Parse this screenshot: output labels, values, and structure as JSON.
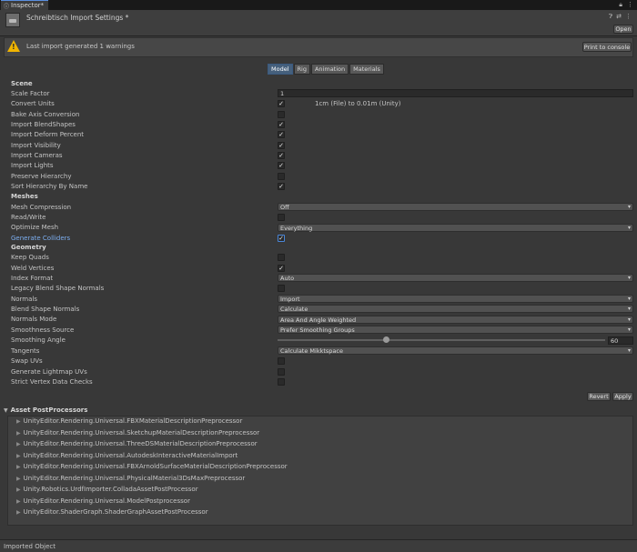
{
  "tab": {
    "title": "Inspector*",
    "menu_icon": "kebab-icon"
  },
  "header": {
    "title": "Schreibtisch Import Settings *",
    "open_label": "Open"
  },
  "warning": {
    "text": "Last import generated 1 warnings",
    "button": "Print to console"
  },
  "subtabs": [
    "Model",
    "Rig",
    "Animation",
    "Materials"
  ],
  "scene": {
    "heading": "Scene",
    "scale_factor_label": "Scale Factor",
    "scale_factor_value": "1",
    "convert_units_label": "Convert Units",
    "convert_units_note": "1cm (File) to 0.01m (Unity)",
    "bake_axis_label": "Bake Axis Conversion",
    "blendshapes_label": "Import BlendShapes",
    "deform_label": "Import Deform Percent",
    "visibility_label": "Import Visibility",
    "cameras_label": "Import Cameras",
    "lights_label": "Import Lights",
    "preserve_label": "Preserve Hierarchy",
    "sort_label": "Sort Hierarchy By Name"
  },
  "meshes": {
    "heading": "Meshes",
    "compression_label": "Mesh Compression",
    "compression_value": "Off",
    "readwrite_label": "Read/Write",
    "optimize_label": "Optimize Mesh",
    "optimize_value": "Everything",
    "colliders_label": "Generate Colliders"
  },
  "geometry": {
    "heading": "Geometry",
    "keep_quads_label": "Keep Quads",
    "weld_label": "Weld Vertices",
    "index_label": "Index Format",
    "index_value": "Auto",
    "legacy_label": "Legacy Blend Shape Normals",
    "normals_label": "Normals",
    "normals_value": "Import",
    "bs_normals_label": "Blend Shape Normals",
    "bs_normals_value": "Calculate",
    "normals_mode_label": "Normals Mode",
    "normals_mode_value": "Area And Angle Weighted",
    "smooth_src_label": "Smoothness Source",
    "smooth_src_value": "Prefer Smoothing Groups",
    "smooth_angle_label": "Smoothing Angle",
    "smooth_angle_value": "60",
    "smooth_angle_fraction": 0.333,
    "tangents_label": "Tangents",
    "tangents_value": "Calculate Mikktspace",
    "swap_uv_label": "Swap UVs",
    "lightmap_label": "Generate Lightmap UVs",
    "strict_label": "Strict Vertex Data Checks"
  },
  "actions": {
    "revert": "Revert",
    "apply": "Apply"
  },
  "post_processors": {
    "heading": "Asset PostProcessors",
    "items": [
      "UnityEditor.Rendering.Universal.FBXMaterialDescriptionPreprocessor",
      "UnityEditor.Rendering.Universal.SketchupMaterialDescriptionPreprocessor",
      "UnityEditor.Rendering.Universal.ThreeDSMaterialDescriptionPreprocessor",
      "UnityEditor.Rendering.Universal.AutodeskInteractiveMaterialImport",
      "UnityEditor.Rendering.Universal.FBXArnoldSurfaceMaterialDescriptionPreprocessor",
      "UnityEditor.Rendering.Universal.PhysicalMaterial3DsMaxPreprocessor",
      "Unity.Robotics.UrdfImporter.ColladaAssetPostProcessor",
      "UnityEditor.Rendering.Universal.ModelPostprocessor",
      "UnityEditor.ShaderGraph.ShaderGraphAssetPostProcessor"
    ]
  },
  "footer": {
    "label": "Imported Object"
  }
}
